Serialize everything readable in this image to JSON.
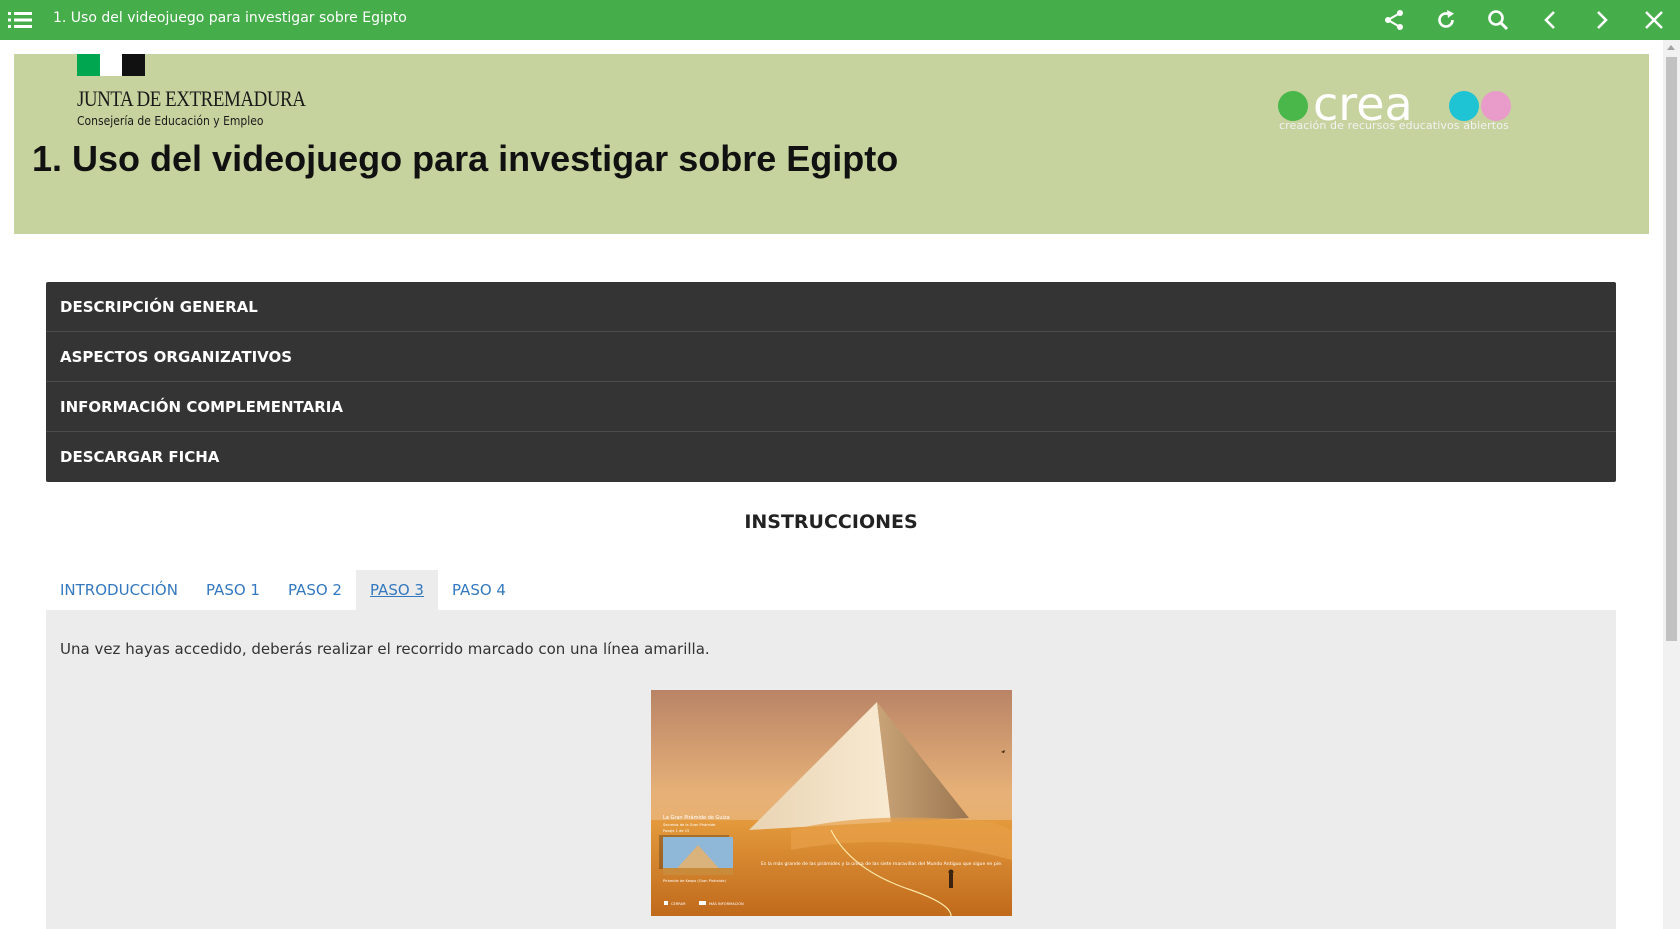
{
  "toolbar": {
    "title": "1. Uso del videojuego para investigar sobre Egipto",
    "icons": {
      "menu": "list-menu-icon",
      "share": "share-icon",
      "reload": "reload-icon",
      "search": "search-icon",
      "previous": "chevron-left-icon",
      "next": "chevron-right-icon",
      "close": "close-icon"
    },
    "background_color": "#46ad4b"
  },
  "header": {
    "junta_name": "JUNTA DE EXTREMADURA",
    "junta_subtitle": "Consejería de Educación y Empleo",
    "page_title": "1. Uso del videojuego para investigar sobre Egipto",
    "crea_logo_text": "crea",
    "crea_subtitle": "creación de recursos educativos abiertos",
    "background_color": "#c6d39e"
  },
  "accordion": {
    "items": [
      {
        "label": "DESCRIPCIÓN GENERAL"
      },
      {
        "label": "ASPECTOS ORGANIZATIVOS"
      },
      {
        "label": "INFORMACIÓN COMPLEMENTARIA"
      },
      {
        "label": "DESCARGAR FICHA"
      }
    ]
  },
  "instructions": {
    "heading": "INSTRUCCIONES",
    "tabs": [
      {
        "label": "INTRODUCCIÓN",
        "active": false
      },
      {
        "label": "PASO 1",
        "active": false
      },
      {
        "label": "PASO 2",
        "active": false
      },
      {
        "label": "PASO 3",
        "active": true
      },
      {
        "label": "PASO 4",
        "active": false
      }
    ],
    "active_panel": {
      "text": "Una vez hayas accedido, deberás realizar el recorrido marcado con una línea amarilla.",
      "image": {
        "title": "La Gran Pirámide de Guiza",
        "subtitle": "Secretos de la Gran Pirámide",
        "counter": "Pasaje 1 de 15",
        "thumb_caption": "Pirámide de Keops (Gran Pirámide)",
        "narration": "Es la más grande de las pirámides y la única de las siete maravillas del Mundo Antiguo que sigue en pie.",
        "close_label": "CERRAR",
        "more_info_label": "MÁS INFORMACIÓN"
      }
    }
  }
}
